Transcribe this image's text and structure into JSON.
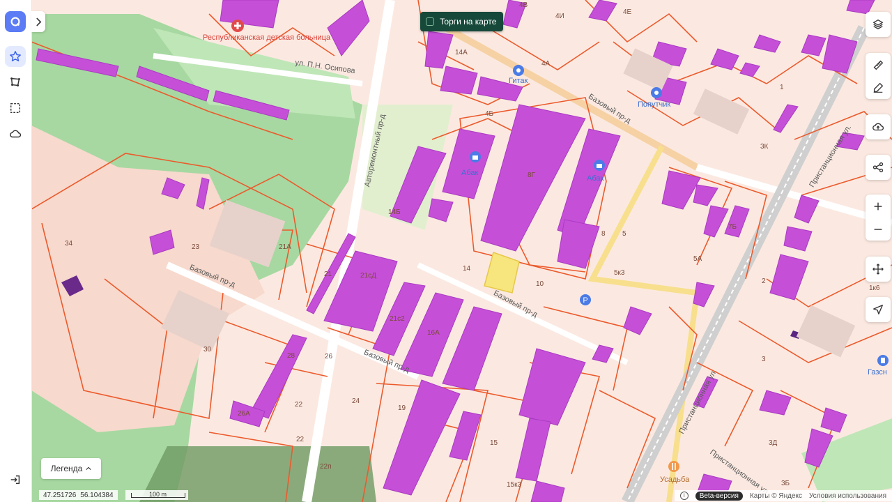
{
  "sidebar": {
    "logo": "app-logo-icon",
    "items": [
      {
        "name": "favorites-icon",
        "active": true
      },
      {
        "name": "polygon-tool-icon",
        "active": false
      },
      {
        "name": "selection-tool-icon",
        "active": false
      },
      {
        "name": "cloud-icon",
        "active": false
      }
    ],
    "logout": "login-icon"
  },
  "auction_toggle": {
    "label": "Торги на карте",
    "checked": false
  },
  "map": {
    "streets": {
      "osipova": "ул. П.Н. Осипова",
      "avtoremontny": "Авторемонтный пр-д",
      "bazovy_ne": "Базовый пр-д",
      "bazovy_w": "Базовый пр-д",
      "bazovy_c": "Базовый пр-д",
      "bazovy_s": "Базовый пр-д",
      "pristantsionnaya_n": "Пристанционная ул.",
      "pristantsionnaya_s": "Пристанционная ул.",
      "pristantsionnaya_se": "Пристанционная ул."
    },
    "places": {
      "hospital": "Республиканская детская больница",
      "abak1": "Абак",
      "abak2": "Абак",
      "polutchik": "Попутчик",
      "gitak": "Гитак",
      "gazsn": "Газсн",
      "usadba": "Усадьба"
    },
    "numbers": [
      "34",
      "23",
      "21А",
      "21",
      "21сД",
      "21с2",
      "16А",
      "14",
      "14Б",
      "10",
      "8Г",
      "8",
      "5",
      "5к3",
      "5А",
      "7Б",
      "3К",
      "3",
      "3Д",
      "3Б",
      "1к6",
      "30",
      "28",
      "26",
      "24",
      "22",
      "22",
      "22п",
      "19",
      "15",
      "15к3",
      "4В",
      "4И",
      "4Е",
      "4А",
      "1",
      "2",
      "4Б",
      "14А",
      "26А"
    ]
  },
  "tools": {
    "layers": "layers-icon",
    "ruler": "ruler-icon",
    "edit": "edit-icon",
    "upload": "cloud-upload-icon",
    "share": "share-icon",
    "zoom_in": "plus-icon",
    "zoom_out": "minus-icon",
    "move": "move-icon",
    "locate": "locate-arrow-icon"
  },
  "legend": {
    "label": "Легенда"
  },
  "coords": {
    "lon": "47.251726",
    "lat": "56.104384"
  },
  "scale": {
    "label": "100 m"
  },
  "attribution": {
    "beta": "Beta-версия",
    "maps": "Карты © Яндекс",
    "terms": "Условия использования"
  },
  "colors": {
    "parcel_border": "#ec5a2c",
    "building_fill": "#c64fd8",
    "green": "#8ed08a",
    "selected_parcel": "#f7e57d",
    "background": "#fbe9e1",
    "accent": "#5b7cf5",
    "auction_bg": "#17493a"
  }
}
